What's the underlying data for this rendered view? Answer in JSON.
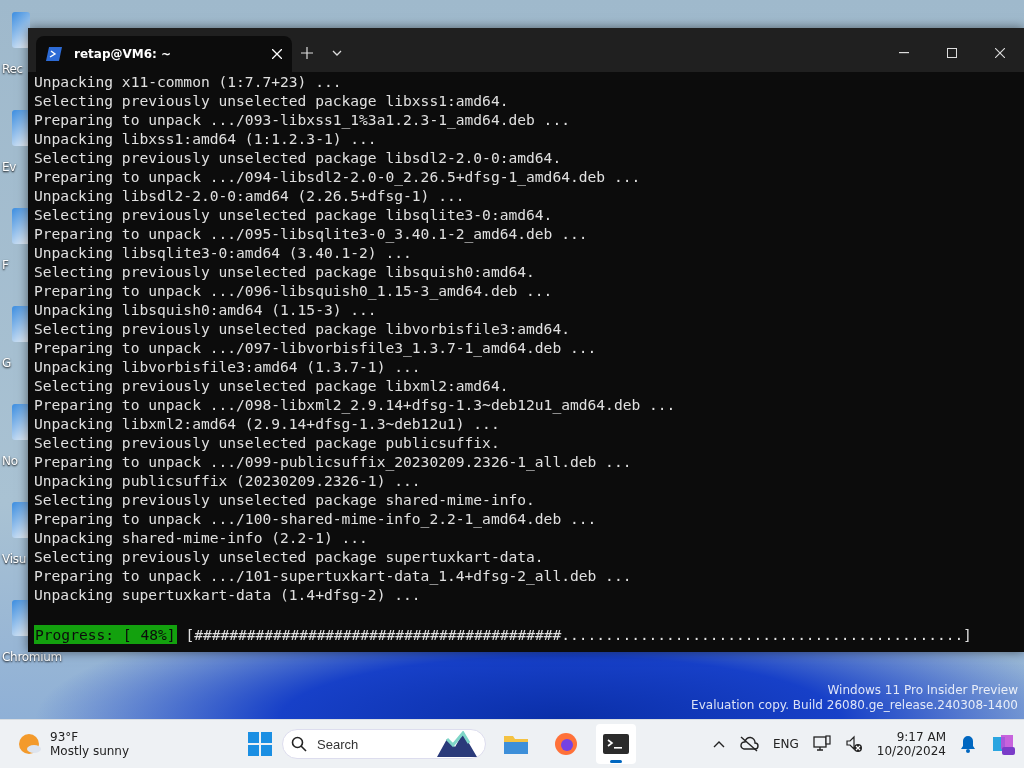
{
  "desktop_icons": [
    {
      "label": "Rec"
    },
    {
      "label": "Ev"
    },
    {
      "label": "F"
    },
    {
      "label": "G"
    },
    {
      "label": "No"
    },
    {
      "label": "Visu"
    },
    {
      "label": "Chromium"
    }
  ],
  "terminal": {
    "tab_title": "retap@VM6: ~",
    "lines": [
      "Unpacking x11-common (1:7.7+23) ...",
      "Selecting previously unselected package libxss1:amd64.",
      "Preparing to unpack .../093-libxss1_1%3a1.2.3-1_amd64.deb ...",
      "Unpacking libxss1:amd64 (1:1.2.3-1) ...",
      "Selecting previously unselected package libsdl2-2.0-0:amd64.",
      "Preparing to unpack .../094-libsdl2-2.0-0_2.26.5+dfsg-1_amd64.deb ...",
      "Unpacking libsdl2-2.0-0:amd64 (2.26.5+dfsg-1) ...",
      "Selecting previously unselected package libsqlite3-0:amd64.",
      "Preparing to unpack .../095-libsqlite3-0_3.40.1-2_amd64.deb ...",
      "Unpacking libsqlite3-0:amd64 (3.40.1-2) ...",
      "Selecting previously unselected package libsquish0:amd64.",
      "Preparing to unpack .../096-libsquish0_1.15-3_amd64.deb ...",
      "Unpacking libsquish0:amd64 (1.15-3) ...",
      "Selecting previously unselected package libvorbisfile3:amd64.",
      "Preparing to unpack .../097-libvorbisfile3_1.3.7-1_amd64.deb ...",
      "Unpacking libvorbisfile3:amd64 (1.3.7-1) ...",
      "Selecting previously unselected package libxml2:amd64.",
      "Preparing to unpack .../098-libxml2_2.9.14+dfsg-1.3~deb12u1_amd64.deb ...",
      "Unpacking libxml2:amd64 (2.9.14+dfsg-1.3~deb12u1) ...",
      "Selecting previously unselected package publicsuffix.",
      "Preparing to unpack .../099-publicsuffix_20230209.2326-1_all.deb ...",
      "Unpacking publicsuffix (20230209.2326-1) ...",
      "Selecting previously unselected package shared-mime-info.",
      "Preparing to unpack .../100-shared-mime-info_2.2-1_amd64.deb ...",
      "Unpacking shared-mime-info (2.2-1) ...",
      "Selecting previously unselected package supertuxkart-data.",
      "Preparing to unpack .../101-supertuxkart-data_1.4+dfsg-2_all.deb ...",
      "Unpacking supertuxkart-data (1.4+dfsg-2) ..."
    ],
    "progress": {
      "label": "Progress: [ 48%]",
      "bar": "[##########################################..............................................]"
    }
  },
  "watermark_text": [
    "Windows 11 Pro Insider Preview",
    "Evaluation copy. Build 26080.ge_release.240308-1400"
  ],
  "taskbar": {
    "weather": {
      "temperature": "93°F",
      "condition": "Mostly sunny"
    },
    "search": {
      "placeholder": "Search"
    },
    "apps": [
      {
        "kind": "files",
        "selected": false
      },
      {
        "kind": "browser",
        "selected": false
      },
      {
        "kind": "terminal",
        "selected": true
      }
    ],
    "tray": {
      "language": "ENG",
      "time": "9:17 AM",
      "date": "10/20/2024"
    }
  }
}
